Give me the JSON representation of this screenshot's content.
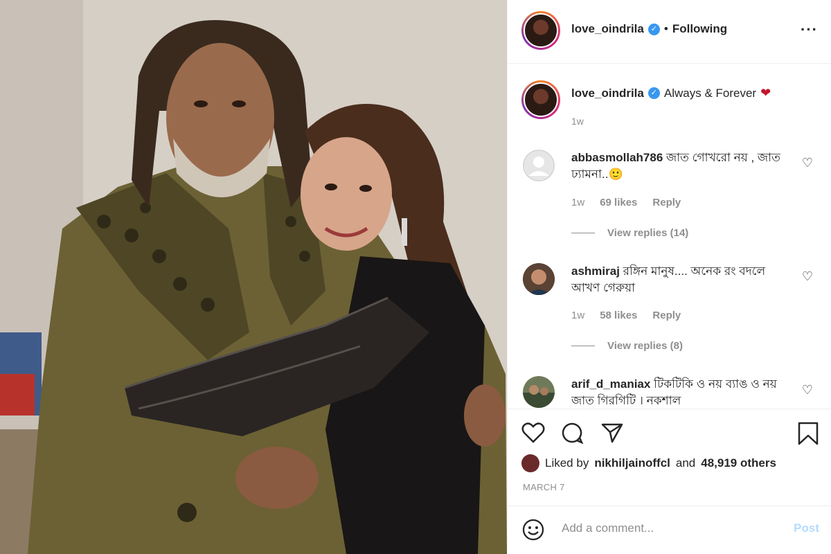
{
  "post": {
    "image_alt": "Photo of a man in an embroidered olive jacket embracing a woman in a black dress"
  },
  "header": {
    "username": "love_oindrila",
    "dot": "•",
    "follow_state": "Following",
    "more_icon": "more-options-icon"
  },
  "caption": {
    "username": "love_oindrila",
    "text": "Always & Forever",
    "emoji": "❤",
    "age": "1w"
  },
  "comments": [
    {
      "username": "abbasmollah786",
      "text": "জাত গোখরো নয় , জাত ঢ্যামনা..🙂",
      "age": "1w",
      "likes": "69 likes",
      "reply": "Reply",
      "view_replies": "View replies (14)"
    },
    {
      "username": "ashmiraj",
      "text": "রঙ্গিন মানুষ.... অনেক রং বদলে আখণ গেরুয়া",
      "age": "1w",
      "likes": "58 likes",
      "reply": "Reply",
      "view_replies": "View replies (8)"
    },
    {
      "username": "arif_d_maniax",
      "text": "টিকটিকি ও নয় ব্যাঙ ও নয় জাত গিরগিটি । নকশাল"
    }
  ],
  "actions": {
    "like_icon": "heart-outline-icon",
    "comment_icon": "comment-icon",
    "share_icon": "share-icon",
    "save_icon": "bookmark-icon"
  },
  "likes": {
    "prefix": "Liked by",
    "user": "nikhiljainoffcl",
    "suffix": "and",
    "others": "48,919 others"
  },
  "date": "MARCH 7",
  "add_comment": {
    "placeholder": "Add a comment...",
    "post_label": "Post",
    "emoji_icon": "smiley-icon"
  }
}
